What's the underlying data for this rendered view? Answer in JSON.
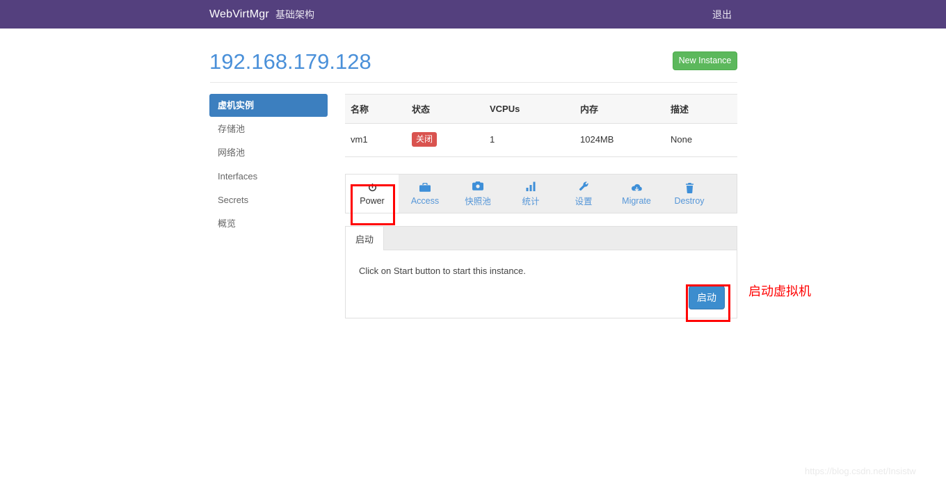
{
  "navbar": {
    "brand": "WebVirtMgr",
    "infra_link": "基础架构",
    "logout_link": "退出"
  },
  "header": {
    "title": "192.168.179.128",
    "new_instance_label": "New Instance"
  },
  "sidebar": {
    "items": [
      {
        "label": "虚机实例",
        "active": true
      },
      {
        "label": "存储池",
        "active": false
      },
      {
        "label": "网络池",
        "active": false
      },
      {
        "label": "Interfaces",
        "active": false
      },
      {
        "label": "Secrets",
        "active": false
      },
      {
        "label": "概览",
        "active": false
      }
    ]
  },
  "instances_table": {
    "columns": [
      "名称",
      "状态",
      "VCPUs",
      "内存",
      "描述"
    ],
    "rows": [
      {
        "name": "vm1",
        "state": "关闭",
        "state_color": "#d9534f",
        "vcpus": "1",
        "memory": "1024MB",
        "description": "None"
      }
    ]
  },
  "toolbar": {
    "tabs": [
      {
        "label": "Power",
        "icon": "power-icon",
        "active": true
      },
      {
        "label": "Access",
        "icon": "briefcase-icon",
        "active": false
      },
      {
        "label": "快照池",
        "icon": "camera-icon",
        "active": false
      },
      {
        "label": "统计",
        "icon": "bar-chart-icon",
        "active": false
      },
      {
        "label": "设置",
        "icon": "wrench-icon",
        "active": false
      },
      {
        "label": "Migrate",
        "icon": "cloud-download-icon",
        "active": false
      },
      {
        "label": "Destroy",
        "icon": "trash-icon",
        "active": false
      }
    ]
  },
  "panel": {
    "tab_label": "启动",
    "message": "Click on Start button to start this instance.",
    "start_button_label": "启动"
  },
  "annotation": {
    "label": "启动虚拟机",
    "color": "#ff0000"
  },
  "watermark": "https://blog.csdn.net/Insistw",
  "colors": {
    "navbar": "#54407e",
    "title": "#4a90d9",
    "sidebar_active": "#3c7fbf",
    "new_instance": "#5cb85c",
    "start_button": "#3c8dce",
    "badge_danger": "#d9534f"
  }
}
